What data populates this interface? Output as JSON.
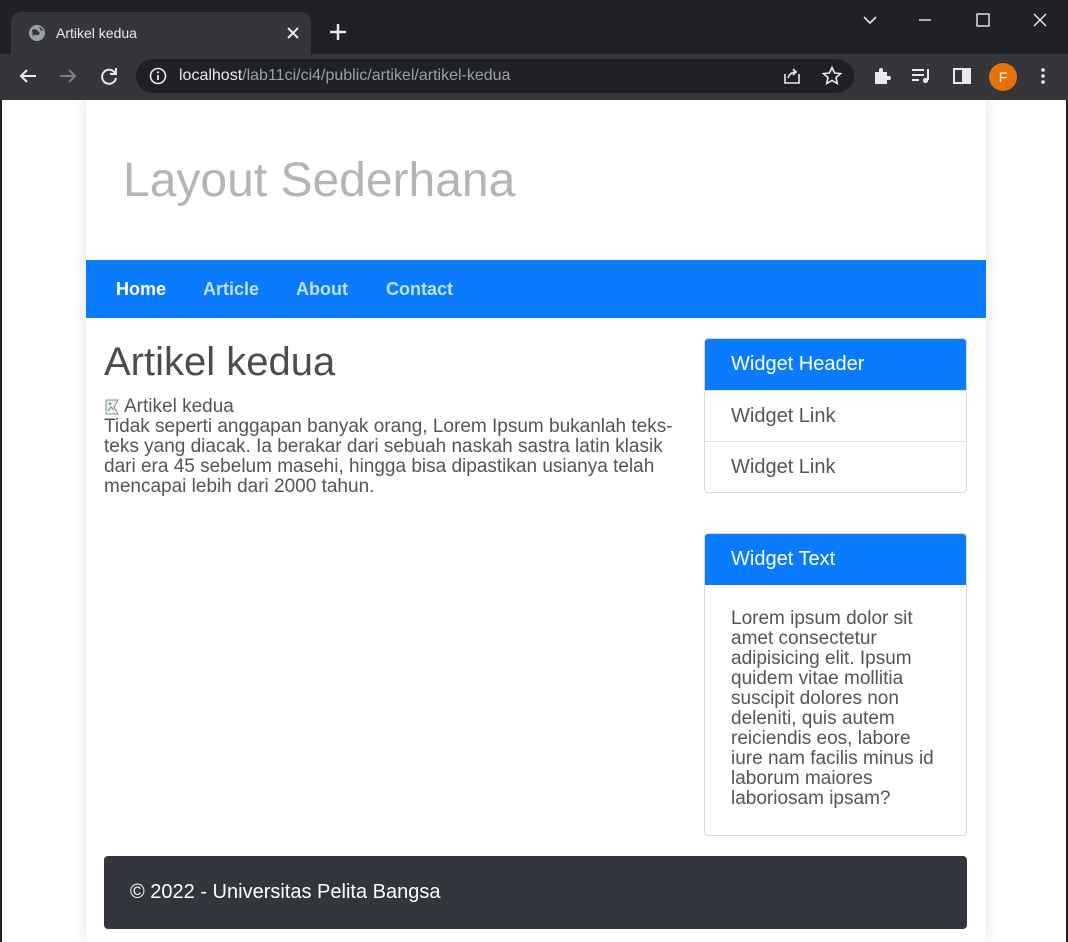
{
  "browser": {
    "tab_title": "Artikel kedua",
    "url_host": "localhost",
    "url_path": "/lab11ci/ci4/public/artikel/artikel-kedua",
    "profile_initial": "F",
    "colors": {
      "frame": "#202124",
      "toolbar": "#35363a",
      "profile": "#e8710a"
    }
  },
  "site": {
    "title": "Layout Sederhana",
    "nav": [
      "Home",
      "Article",
      "About",
      "Contact"
    ],
    "active_nav": "Home",
    "colors": {
      "nav_bg": "#0a7bff",
      "footer_bg": "#33363d"
    }
  },
  "article": {
    "title": "Artikel kedua",
    "image_alt": "Artikel kedua",
    "body": "Tidak seperti anggapan banyak orang, Lorem Ipsum bukanlah teks-teks yang diacak. Ia berakar dari sebuah naskah sastra latin klasik dari era 45 sebelum masehi, hingga bisa dipastikan usianya telah mencapai lebih dari 2000 tahun."
  },
  "sidebar": {
    "widget1": {
      "header": "Widget Header",
      "links": [
        "Widget Link",
        "Widget Link"
      ]
    },
    "widget2": {
      "header": "Widget Text",
      "text": "Lorem ipsum dolor sit amet consectetur adipisicing elit. Ipsum quidem vitae mollitia suscipit dolores non deleniti, quis autem reiciendis eos, labore iure nam facilis minus id laborum maiores laboriosam ipsam?"
    }
  },
  "footer": {
    "text": "© 2022 - Universitas Pelita Bangsa"
  }
}
